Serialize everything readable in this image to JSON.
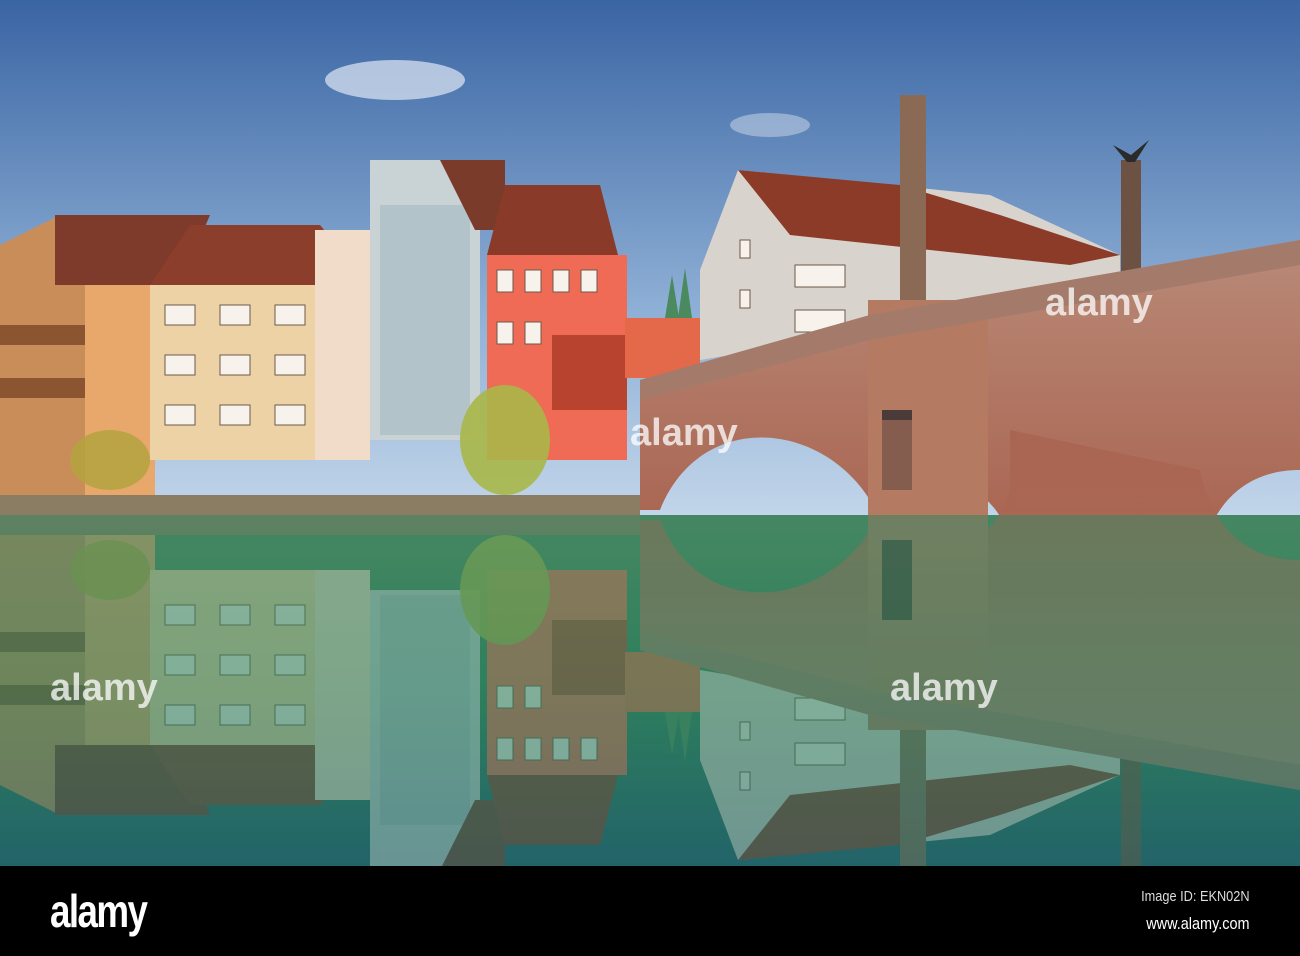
{
  "photo": {
    "subject": "Riverside houses and stone bridge reflected in river",
    "watermark_text": "alamy",
    "colors": {
      "sky_top": "#3a65a3",
      "sky_bottom": "#c3d6ea",
      "water": "#2f7f5c",
      "sandstone": "#b8735f"
    }
  },
  "footer": {
    "logo": "alamy",
    "image_id": "Image ID: EKN02N",
    "url": "www.alamy.com"
  }
}
